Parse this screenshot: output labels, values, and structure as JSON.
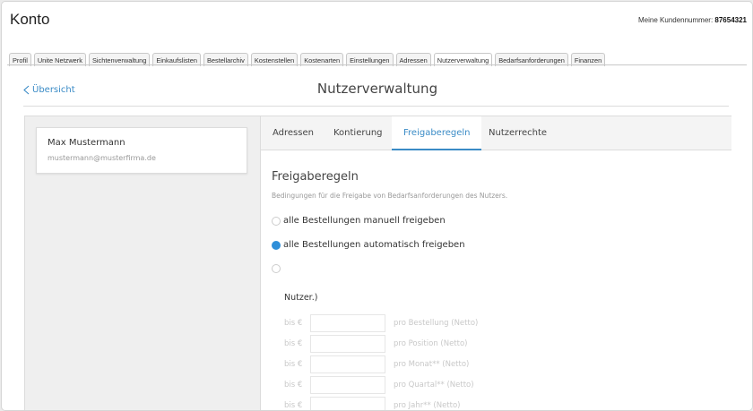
{
  "header": {
    "title": "Konto",
    "customer_label": "Meine Kundennummer:",
    "customer_number": "87654321"
  },
  "nav_tabs": [
    {
      "label": "Profil"
    },
    {
      "label": "Unite Netzwerk"
    },
    {
      "label": "Sichtenverwaltung"
    },
    {
      "label": "Einkaufslisten"
    },
    {
      "label": "Bestellarchiv"
    },
    {
      "label": "Kostenstellen"
    },
    {
      "label": "Kostenarten"
    },
    {
      "label": "Einstellungen"
    },
    {
      "label": "Adressen"
    },
    {
      "label": "Nutzerverwaltung",
      "active": true
    },
    {
      "label": "Bedarfsanforderungen"
    },
    {
      "label": "Finanzen"
    }
  ],
  "page": {
    "back_label": "Übersicht",
    "title": "Nutzerverwaltung"
  },
  "user": {
    "name": "Max Mustermann",
    "email": "mustermann@musterfirma.de"
  },
  "panel_tabs": [
    {
      "label": "Adressen"
    },
    {
      "label": "Kontierung"
    },
    {
      "label": "Freigaberegeln",
      "active": true
    },
    {
      "label": "Nutzerrechte"
    }
  ],
  "rules": {
    "title": "Freigaberegeln",
    "description": "Bedingungen für die Freigabe von Bedarfsanforderungen des Nutzers.",
    "options": [
      {
        "label": "alle Bestellungen manuell freigeben",
        "checked": false
      },
      {
        "label": "alle Bestellungen automatisch freigeben",
        "checked": true
      },
      {
        "label": "",
        "checked": false
      }
    ],
    "sub_label": "Nutzer.)",
    "limits": [
      {
        "prefix": "bis €",
        "value": "",
        "suffix": "pro Bestellung (Netto)"
      },
      {
        "prefix": "bis €",
        "value": "",
        "suffix": "pro Position (Netto)"
      },
      {
        "prefix": "bis €",
        "value": "",
        "suffix": "pro Monat** (Netto)"
      },
      {
        "prefix": "bis €",
        "value": "",
        "suffix": "pro Quartal** (Netto)"
      },
      {
        "prefix": "bis €",
        "value": "",
        "suffix": "pro Jahr** (Netto)"
      }
    ]
  },
  "colors": {
    "accent": "#3a8bc6",
    "radio_checked": "#2e8fd9"
  }
}
